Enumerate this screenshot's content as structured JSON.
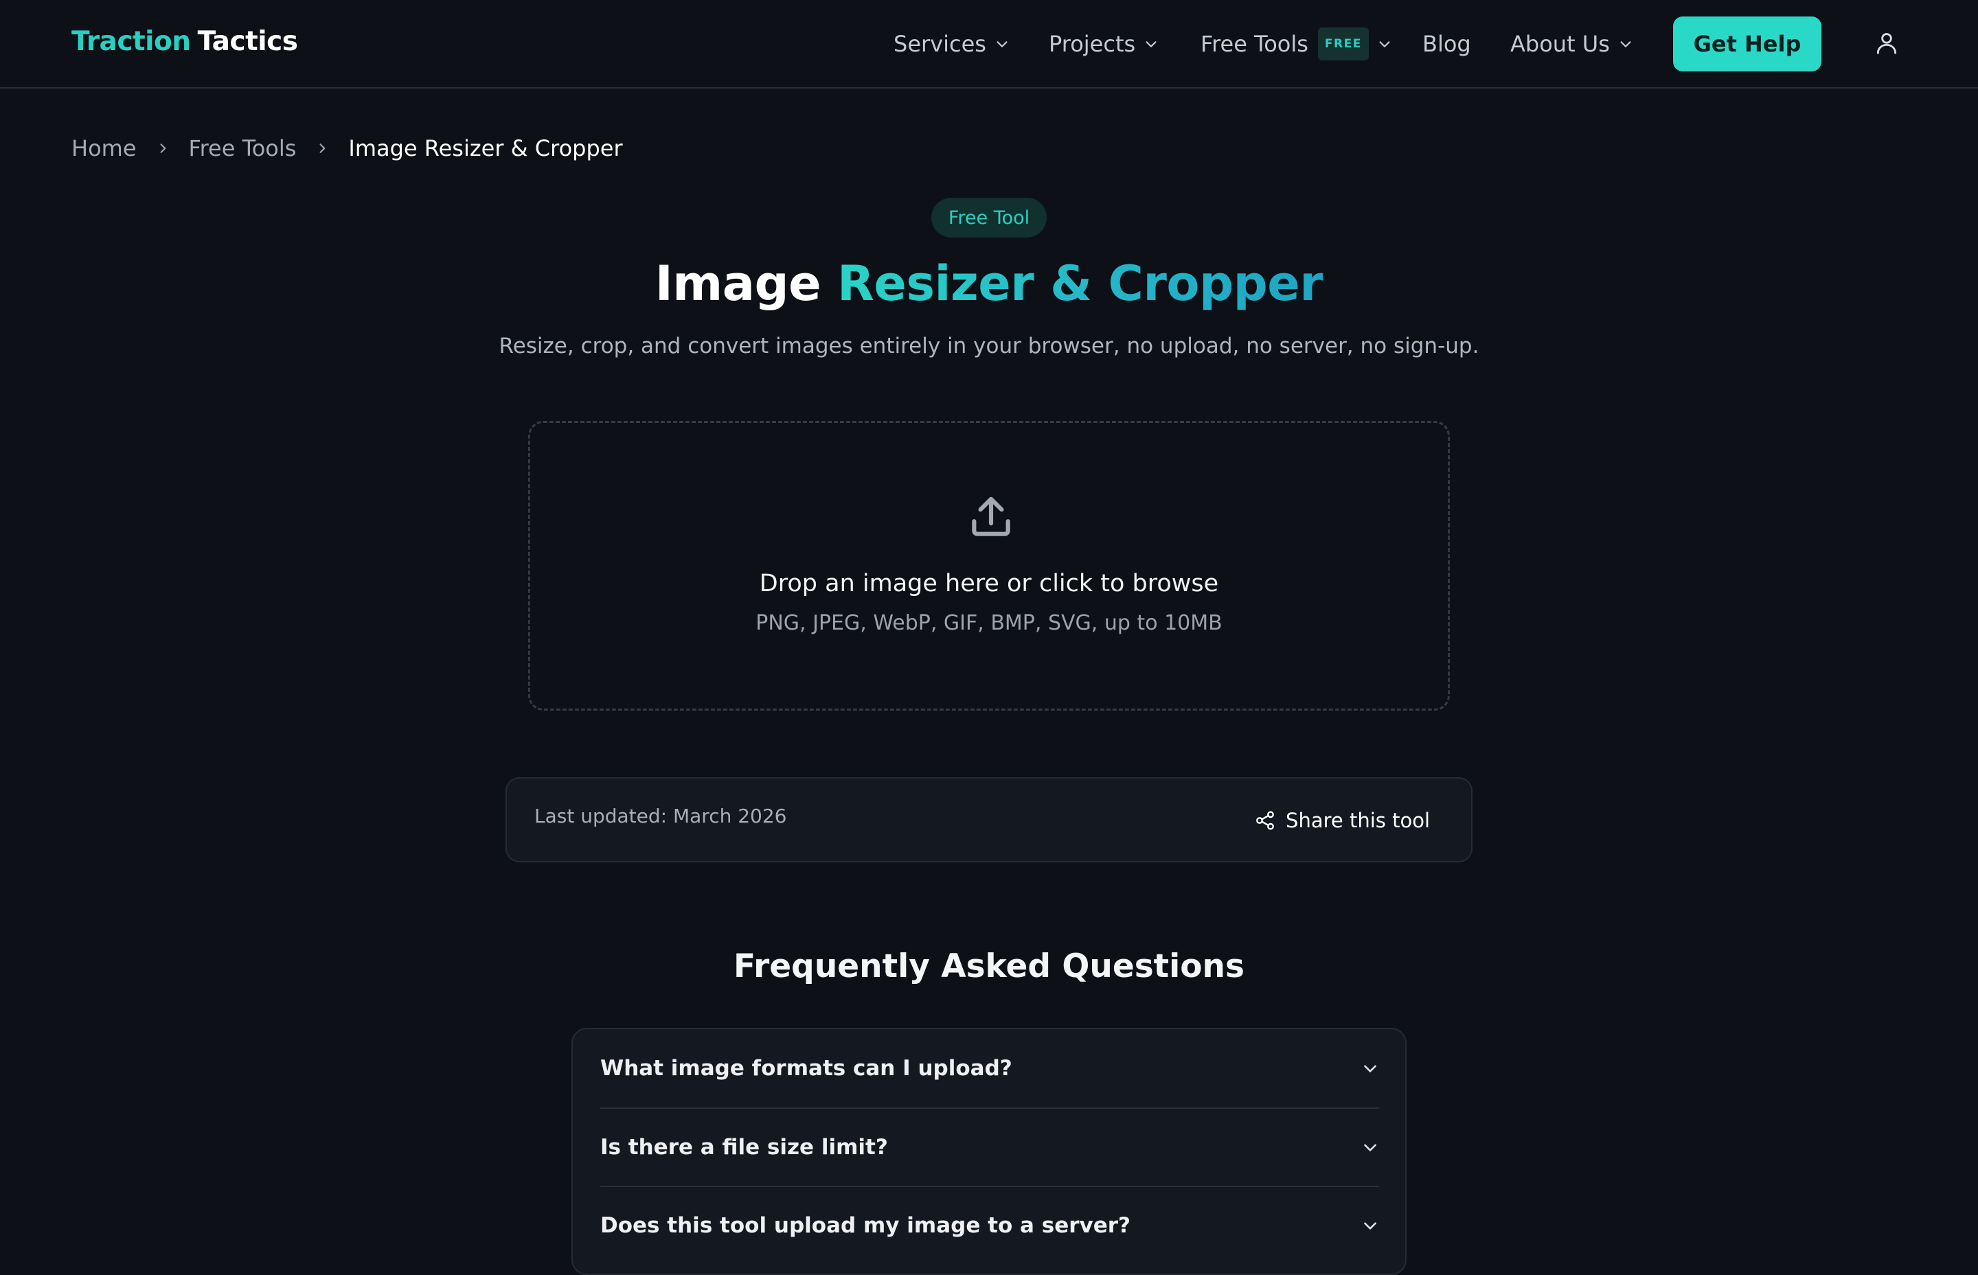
{
  "brand": {
    "part1": "Traction",
    "part2": "Tactics",
    "accent_color": "#2bcfc1"
  },
  "nav": {
    "items": [
      {
        "label": "Services",
        "dropdown": true
      },
      {
        "label": "Projects",
        "dropdown": true
      },
      {
        "label": "Free Tools",
        "badge": "FREE",
        "dropdown": true
      },
      {
        "label": "Blog",
        "dropdown": false
      },
      {
        "label": "About Us",
        "dropdown": true
      }
    ],
    "cta_label": "Get Help",
    "account_icon": "user-icon"
  },
  "breadcrumb": {
    "items": [
      "Home",
      "Free Tools"
    ],
    "current": "Image Resizer & Cropper"
  },
  "hero": {
    "pill": "Free Tool",
    "title_plain": "Image",
    "title_accent": "Resizer & Cropper",
    "subtitle": "Resize, crop, and convert images entirely in your browser, no upload, no server, no sign-up."
  },
  "dropzone": {
    "icon": "upload-icon",
    "title": "Drop an image here or click to browse",
    "subtitle": "PNG, JPEG, WebP, GIF, BMP, SVG, up to 10MB"
  },
  "meta": {
    "updated": "Last updated: March 2026",
    "share_label": "Share this tool",
    "share_icon": "share-icon"
  },
  "faq": {
    "title": "Frequently Asked Questions",
    "items": [
      {
        "q": "What image formats can I upload?"
      },
      {
        "q": "Is there a file size limit?"
      },
      {
        "q": "Does this tool upload my image to a server?"
      }
    ]
  }
}
